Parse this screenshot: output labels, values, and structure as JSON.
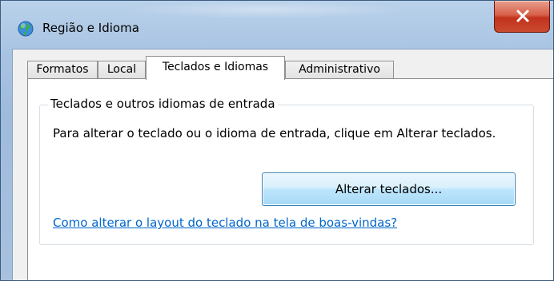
{
  "window": {
    "title": "Região e Idioma",
    "icon": "globe-icon",
    "close_icon": "close-icon"
  },
  "tabs": [
    {
      "label": "Formatos",
      "active": false
    },
    {
      "label": "Local",
      "active": false
    },
    {
      "label": "Teclados e Idiomas",
      "active": true
    },
    {
      "label": "Administrativo",
      "active": false
    }
  ],
  "group": {
    "legend": "Teclados e outros idiomas de entrada",
    "description": "Para alterar o teclado ou o idioma de entrada, clique em Alterar teclados.",
    "change_button_label": "Alterar teclados...",
    "help_link": "Como alterar o layout do teclado na tela de boas-vindas?"
  },
  "colors": {
    "link": "#0066cc",
    "close_button": "#c2321c",
    "button_border": "#3c7fb1"
  }
}
